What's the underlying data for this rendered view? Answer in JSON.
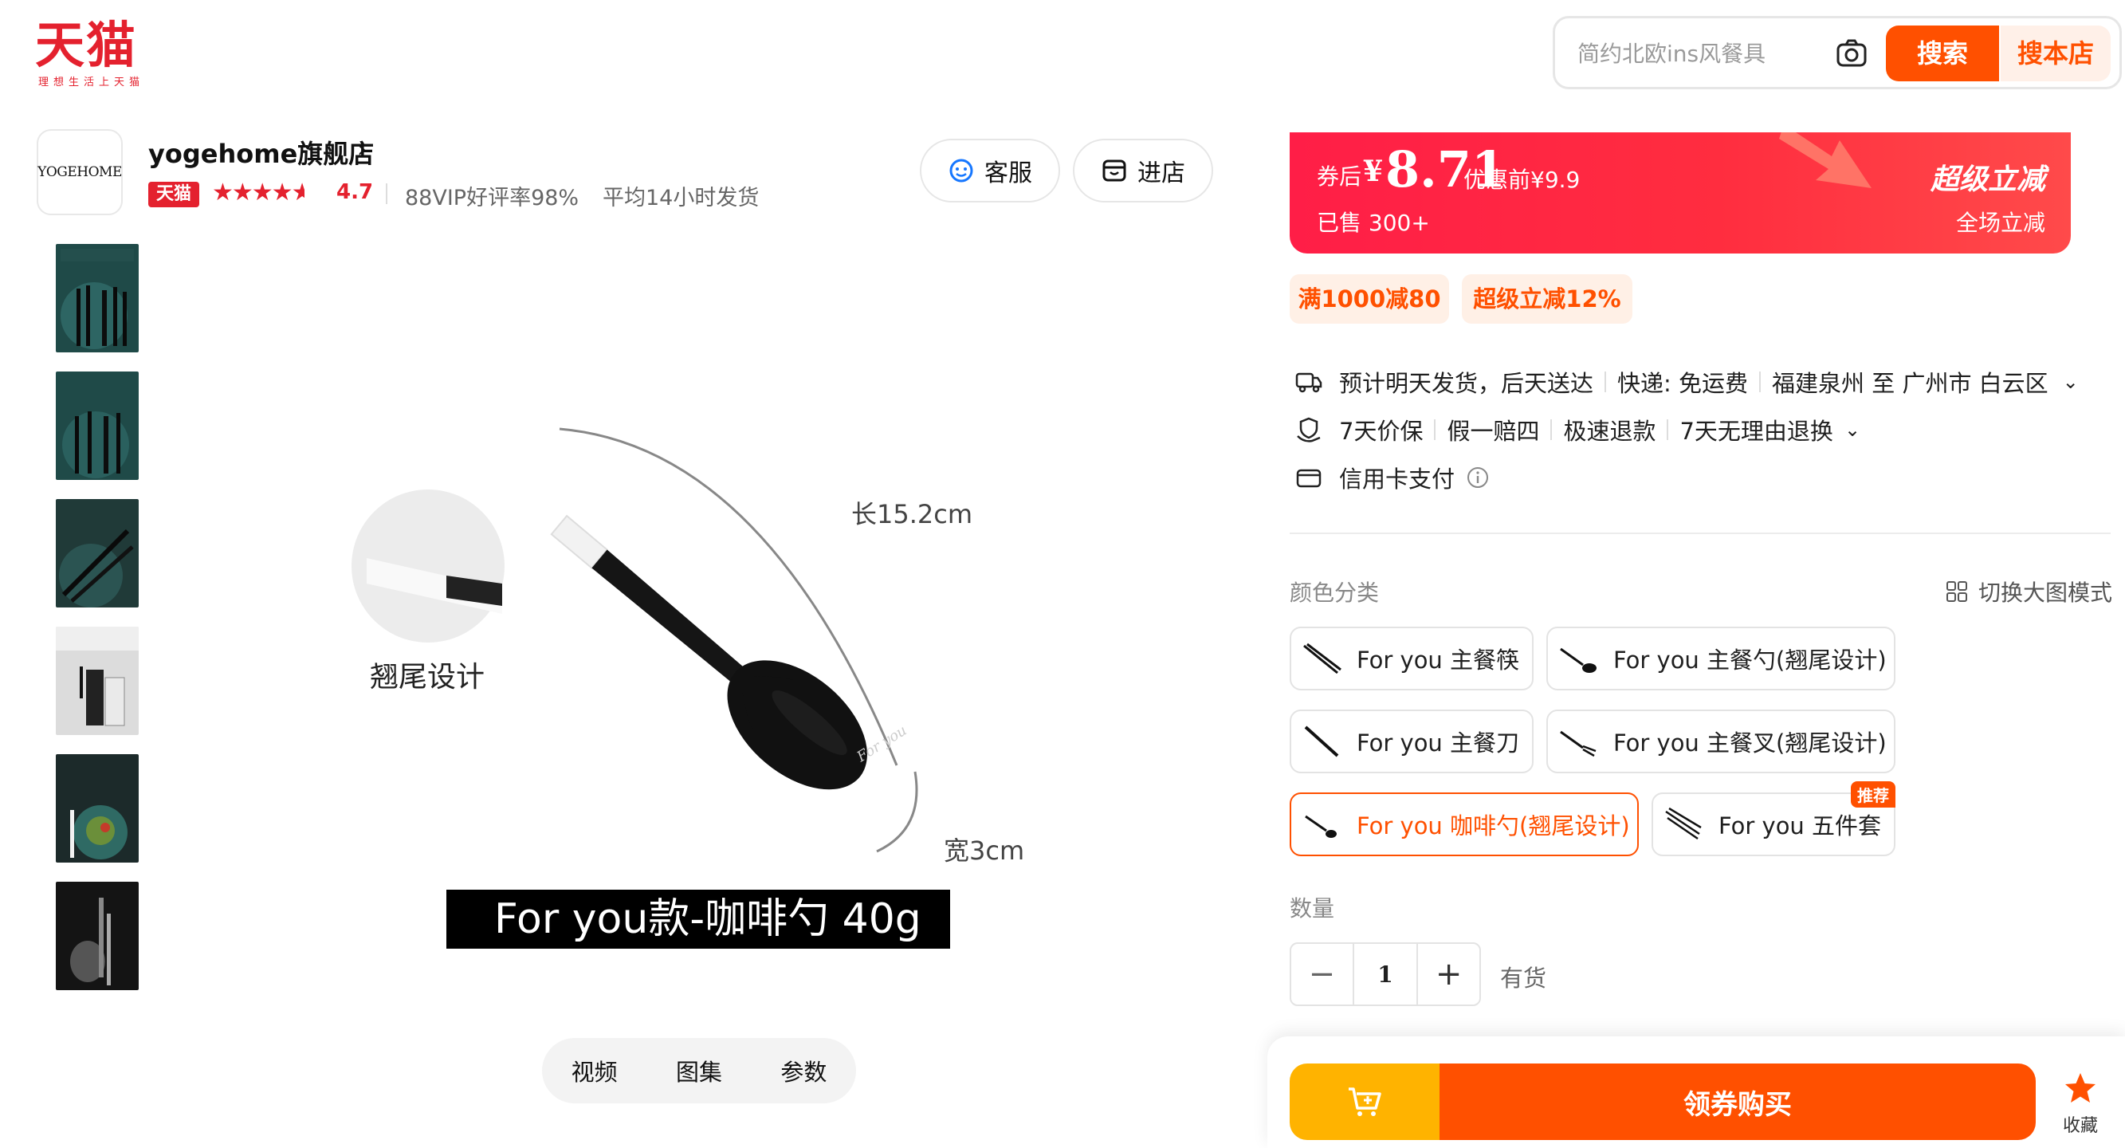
{
  "header": {
    "logo_text": "天猫",
    "logo_slogan": "理想生活上天猫",
    "search_placeholder": "简约北欧ins风餐具",
    "search_button": "搜索",
    "search_store_button": "搜本店"
  },
  "store": {
    "logo_text": "YOGEHOME",
    "name": "yogehome旗舰店",
    "badge": "天猫",
    "rating": "4.7",
    "stars_value": 4.7,
    "vip_rate": "88VIP好评率98%",
    "ship_time": "平均14小时发货",
    "service_button": "客服",
    "enter_button": "进店"
  },
  "gallery": {
    "caption": "For you款-咖啡勺  40g",
    "detail_label": "翘尾设计",
    "length_label": "长15.2cm",
    "width_label": "宽3cm",
    "tabs": [
      "视频",
      "图集",
      "参数"
    ]
  },
  "price": {
    "after_coupon_label": "券后",
    "currency": "¥",
    "amount": "8.71",
    "before_discount": "优惠前¥9.9",
    "sold": "已售 300+",
    "super_label": "超级立减",
    "all_label": "全场立减"
  },
  "promos": [
    "满1000减80",
    "超级立减12%"
  ],
  "delivery": {
    "estimate": "预计明天发货，后天送达",
    "express": "快递: 免运费",
    "route": "福建泉州 至 广州市 白云区"
  },
  "guarantees": [
    "7天价保",
    "假一赔四",
    "极速退款",
    "7天无理由退换"
  ],
  "payment": "信用卡支付",
  "options": {
    "color_label": "颜色分类",
    "switch_mode": "切换大图模式",
    "skus": [
      {
        "label": "For you 主餐筷"
      },
      {
        "label": "For you 主餐勺(翘尾设计)"
      },
      {
        "label": "For you 主餐刀"
      },
      {
        "label": "For you 主餐叉(翘尾设计)"
      },
      {
        "label": "For you 咖啡勺(翘尾设计)",
        "selected": true
      },
      {
        "label": "For you 五件套",
        "badge": "推荐"
      }
    ],
    "quantity_label": "数量",
    "quantity": "1",
    "stock": "有货"
  },
  "actions": {
    "buy_button": "领券购买",
    "favorite": "收藏"
  },
  "colors": {
    "accent": "#ff5000",
    "tmall_red": "#e4212e",
    "banner_red": "#ff1e47",
    "cart_yellow": "#ffb300"
  }
}
